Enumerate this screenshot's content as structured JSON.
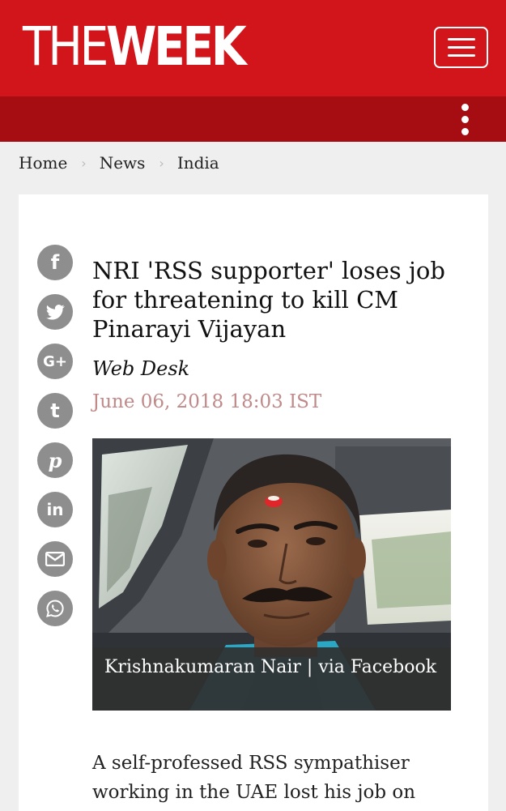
{
  "header": {
    "logo_the": "THE",
    "logo_week": "WEEK",
    "menu_icon": "hamburger-menu-icon",
    "more_icon": "vertical-dots-icon",
    "primary_color": "#d2141b",
    "secondary_color": "#a50d12"
  },
  "breadcrumb": {
    "items": [
      "Home",
      "News",
      "India"
    ],
    "separator": "›"
  },
  "share": {
    "icons": [
      "facebook-icon",
      "twitter-icon",
      "google-plus-icon",
      "tumblr-icon",
      "pinterest-icon",
      "linkedin-icon",
      "email-icon",
      "whatsapp-icon"
    ],
    "facebook": "f",
    "google_plus": "G+",
    "tumblr": "t",
    "pinterest": "p",
    "linkedin": "in"
  },
  "article": {
    "title": "NRI 'RSS supporter' loses job for threatening to kill CM Pinarayi Vijayan",
    "author": "Web Desk",
    "date": "June 06, 2018 18:03 IST",
    "image_caption": "Krishnakumaran Nair | via Facebook",
    "body_start": "A self-professed RSS sympathiser working in the UAE lost his job on"
  }
}
